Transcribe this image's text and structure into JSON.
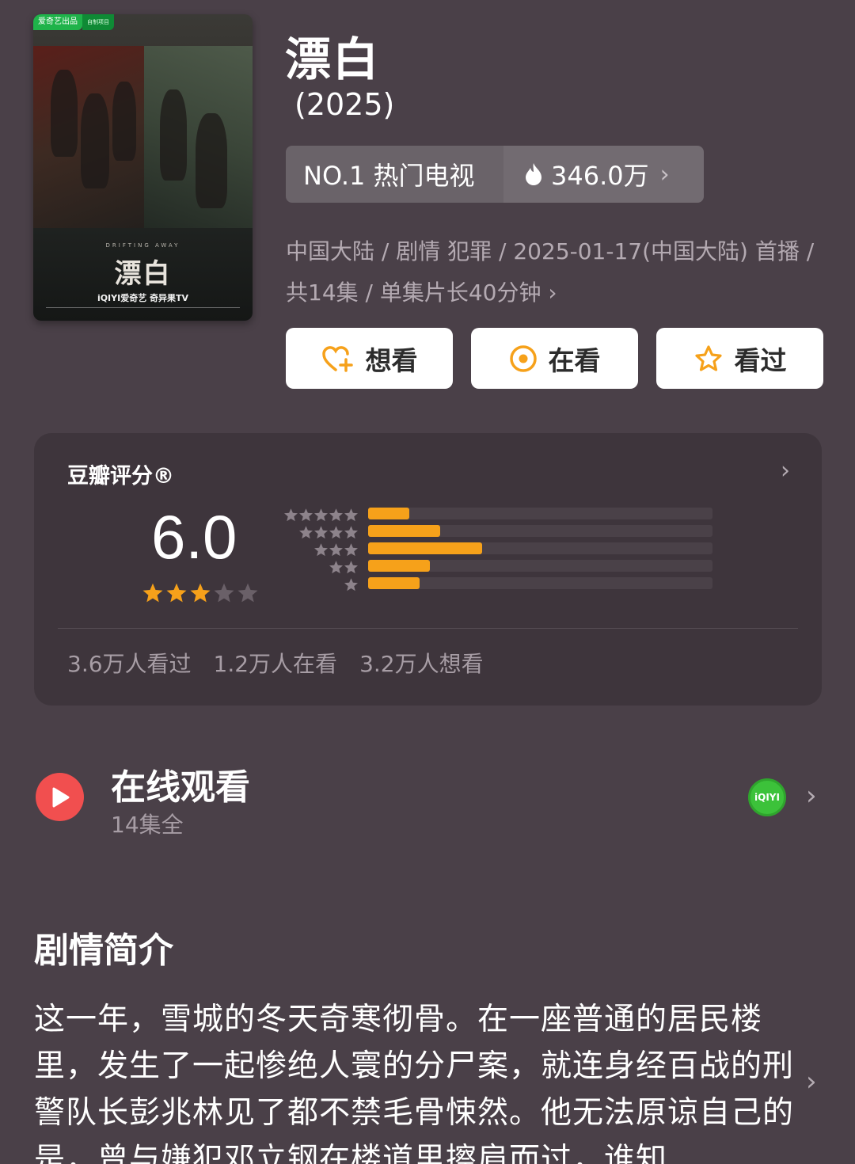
{
  "poster": {
    "badge": "爱奇艺出品",
    "badge2": "自制项目",
    "title_text": "漂白",
    "subtitle_text": "DRIFTING AWAY",
    "logos_text": "iQIYI爱奇艺 奇异果TV"
  },
  "header": {
    "title": "漂白",
    "year": "(2025)"
  },
  "ranking": {
    "label": "NO.1 热门电视",
    "heat": "346.0万",
    "chevron": "›"
  },
  "meta": {
    "text": "中国大陆 / 剧情 犯罪 / 2025-01-17(中国大陆) 首播 / 共14集 / 单集片长40分钟",
    "chevron": "›"
  },
  "actions": {
    "want": "想看",
    "watching": "在看",
    "watched": "看过"
  },
  "rating": {
    "label": "豆瓣评分®",
    "score": "6.0",
    "stars": 3,
    "stars_max": 5,
    "distribution": [
      {
        "stars": 5,
        "fraction": 0.12
      },
      {
        "stars": 4,
        "fraction": 0.21
      },
      {
        "stars": 3,
        "fraction": 0.33
      },
      {
        "stars": 2,
        "fraction": 0.18
      },
      {
        "stars": 1,
        "fraction": 0.15
      }
    ],
    "stats": {
      "watched": "3.6万人看过",
      "watching": "1.2万人在看",
      "want": "3.2万人想看"
    }
  },
  "online": {
    "title": "在线观看",
    "episodes": "14集全",
    "provider": "iQIYI"
  },
  "synopsis": {
    "title": "剧情简介",
    "text": "这一年，雪城的冬天奇寒彻骨。在一座普通的居民楼里，发生了一起惨绝人寰的分尸案，就连身经百战的刑警队长彭兆林见了都不禁毛骨悚然。他无法原谅自己的是，曾与嫌犯邓立钢在楼道里擦肩而过，谁知"
  },
  "colors": {
    "background": "#4a4048",
    "card": "#3e353c",
    "star": "#f6a11a",
    "play": "#f14f4f",
    "iqiyi": "#3cc23a"
  }
}
